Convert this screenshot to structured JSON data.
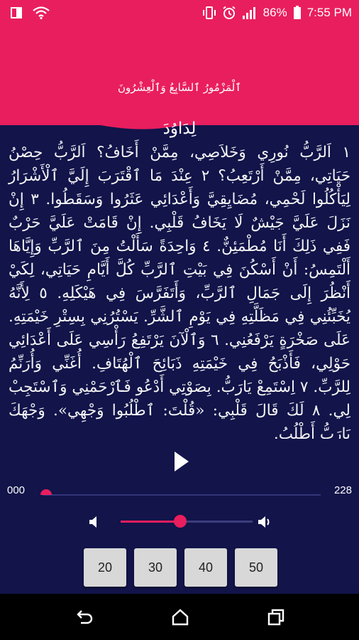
{
  "status_bar": {
    "battery_percent": "86%",
    "time": "7:55 PM",
    "icons": [
      "sim-card-icon",
      "wifi-icon",
      "vibrate-icon",
      "alarm-icon",
      "signal-icon",
      "battery-icon"
    ]
  },
  "header": {
    "title": "ٱلْمَزْمُورُ ٱلسَّابِعُ وَٱلْعِشْرُونَ"
  },
  "psalm": {
    "heading": "لِدَاوُدَ",
    "body": "١ اَلرَّبُّ نُورِي وَخَلاَصِي، مِمَّنْ أَخَافُ؟ اَلرَّبُّ حِصْنُ حَيَاتِي، مِمَّنْ أَرْتَعِبُ؟ ٢ عِنْدَ مَا ٱقْتَرَبَ إِلَيَّ ٱلْأَشْرَارُ لِيَأْكُلُوا لَحْمِي، مُضَايِقِيَّ وَأَعْدَائِي عَثَرُوا وَسَقَطُوا. ٣ إِنْ نَزَلَ عَلَيَّ جَيْشٌ لَا يَخَافُ قَلْبِي. إِنْ قَامَتْ عَلَيَّ حَرْبٌ فَفِي ذَلِكَ أَنَا مُطْمَئِنٌّ. ٤ وَاحِدَةً سَأَلْتُ مِنَ ٱلرَّبِّ وَإِيَّاهَا أَلْتَمِسُ: أَنْ أَسْكُنَ فِي بَيْتِ ٱلرَّبِّ كُلَّ أَيَّامِ حَيَاتِي، لِكَيْ أَنْظُرَ إِلَى جَمَالِ ٱلرَّبِّ، وَأَتَفَرَّسَ فِي هَيْكَلِهِ. ٥ لِأَنَّهُ يُخَبِّئُنِي فِي مَظَلَّتِهِ فِي يَوْمِ ٱلشَّرِّ. يَسْتُرُنِي بِسِتْرِ خَيْمَتِهِ. عَلَى صَخْرَةٍ يَرْفَعُنِي. ٦ وَٱلْآنَ يَرْتَفِعُ رَأْسِي عَلَى أَعْدَائِي حَوْلِي، فَأَذْبَحُ فِي خَيْمَتِهِ ذَبَائِحَ ٱلْهُتَافِ. أُغَنِّي وَأُرَنِّمُ لِلرَّبِّ. ٧ اِسْتَمِعْ يَارَبُّ. بِصَوْتِي أَدْعُو فَٱرْحَمْنِي وَٱسْتَجِبْ لِي. ٨ لَكَ قَالَ قَلْبِي: «قُلْتَ: ٱطْلُبُوا وَجْهِي». وَجْهَكَ يَارَبُّ أَطْلُبُ."
  },
  "player": {
    "current_time": "000",
    "total_time": "228",
    "progress_fraction": 0.0,
    "volume_fraction": 0.45,
    "play_icon": "play-icon",
    "volume_down_icon": "volume-down-icon",
    "volume_up_icon": "volume-up-icon",
    "presets": [
      "20",
      "30",
      "40",
      "50"
    ]
  },
  "nav": {
    "icons": [
      "back-icon",
      "home-icon",
      "recents-icon"
    ]
  },
  "colors": {
    "accent": "#e91e5e",
    "background": "#12144a",
    "button": "#d8d8d8"
  }
}
